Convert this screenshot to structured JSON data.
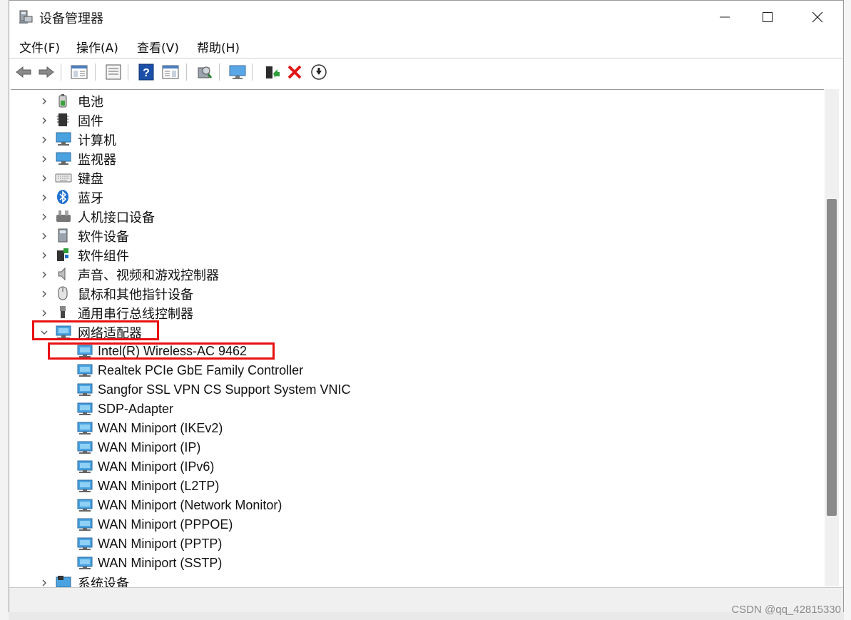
{
  "window": {
    "title": "设备管理器"
  },
  "menu": [
    {
      "label": "文件(F)"
    },
    {
      "label": "操作(A)"
    },
    {
      "label": "查看(V)"
    },
    {
      "label": "帮助(H)"
    }
  ],
  "tree": {
    "categories_before": [
      {
        "label": "电池",
        "icon": "battery-icon"
      },
      {
        "label": "固件",
        "icon": "firmware-icon"
      },
      {
        "label": "计算机",
        "icon": "computer-icon"
      },
      {
        "label": "监视器",
        "icon": "monitor-icon"
      },
      {
        "label": "键盘",
        "icon": "keyboard-icon"
      },
      {
        "label": "蓝牙",
        "icon": "bluetooth-icon"
      },
      {
        "label": "人机接口设备",
        "icon": "hid-icon"
      },
      {
        "label": "软件设备",
        "icon": "software-device-icon"
      },
      {
        "label": "软件组件",
        "icon": "software-component-icon"
      },
      {
        "label": "声音、视频和游戏控制器",
        "icon": "speaker-icon"
      },
      {
        "label": "鼠标和其他指针设备",
        "icon": "mouse-icon"
      },
      {
        "label": "通用串行总线控制器",
        "icon": "usb-icon"
      }
    ],
    "network_adapters": {
      "label": "网络适配器",
      "expanded": true,
      "children": [
        {
          "label": "Intel(R) Wireless-AC 9462"
        },
        {
          "label": "Realtek PCIe GbE Family Controller"
        },
        {
          "label": "Sangfor SSL VPN CS Support System VNIC"
        },
        {
          "label": "SDP-Adapter"
        },
        {
          "label": "WAN Miniport (IKEv2)"
        },
        {
          "label": "WAN Miniport (IP)"
        },
        {
          "label": "WAN Miniport (IPv6)"
        },
        {
          "label": "WAN Miniport (L2TP)"
        },
        {
          "label": "WAN Miniport (Network Monitor)"
        },
        {
          "label": "WAN Miniport (PPPOE)"
        },
        {
          "label": "WAN Miniport (PPTP)"
        },
        {
          "label": "WAN Miniport (SSTP)"
        }
      ]
    },
    "categories_after": [
      {
        "label": "系统设备",
        "icon": "system-device-icon"
      }
    ]
  },
  "highlight_color": "#e81010",
  "watermark": "CSDN @qq_42815330"
}
